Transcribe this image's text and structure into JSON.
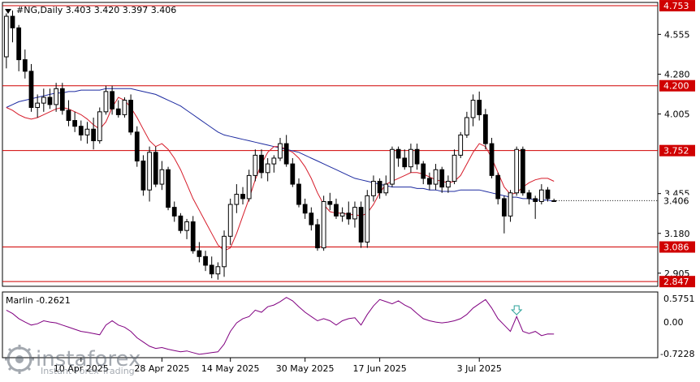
{
  "header": {
    "symbol_line": "#NG,Daily  3.403 3.420 3.397 3.406"
  },
  "indicator": {
    "label": "Marlin -0.2621",
    "levels": [
      "0.5751",
      "0.00",
      "-0.7228"
    ],
    "arrow_icon": "down-arrow-icon"
  },
  "watermark": {
    "brand": "instaforex",
    "tagline": "Instant Forex Trading"
  },
  "colors": {
    "candle": "#000000",
    "ma_fast": "#d61c2a",
    "ma_slow": "#1c2aa0",
    "level_line": "#d00000",
    "indicator_line": "#800080",
    "arrow": "#2aa198",
    "label_bg": "#d00000"
  },
  "chart_data": {
    "type": "candlestick",
    "symbol": "#NG",
    "timeframe": "Daily",
    "last_price": "3.406",
    "price_axis_ticks": [
      "4.555",
      "4.280",
      "4.005",
      "3.455",
      "3.180",
      "2.905"
    ],
    "x_axis_labels": [
      "10 Apr 2025",
      "28 Apr 2025",
      "14 May 2025",
      "30 May 2025",
      "17 Jun 2025",
      "3 Jul 2025"
    ],
    "ylim": [
      2.82,
      4.77
    ],
    "levels": [
      {
        "value": 4.753,
        "label": "4.753"
      },
      {
        "value": 4.2,
        "label": "4.200"
      },
      {
        "value": 3.752,
        "label": "3.752"
      },
      {
        "value": 3.086,
        "label": "3.086"
      },
      {
        "value": 2.847,
        "label": "2.847"
      }
    ],
    "candles": [
      [
        4.4,
        4.7,
        4.32,
        4.68
      ],
      [
        4.68,
        4.72,
        4.5,
        4.6
      ],
      [
        4.6,
        4.62,
        4.3,
        4.38
      ],
      [
        4.38,
        4.45,
        4.25,
        4.3
      ],
      [
        4.3,
        4.35,
        4.02,
        4.05
      ],
      [
        4.05,
        4.14,
        3.98,
        4.08
      ],
      [
        4.08,
        4.18,
        4.02,
        4.12
      ],
      [
        4.12,
        4.18,
        4.04,
        4.07
      ],
      [
        4.07,
        4.22,
        4.02,
        4.18
      ],
      [
        4.18,
        4.22,
        4.0,
        4.03
      ],
      [
        4.03,
        4.1,
        3.92,
        3.96
      ],
      [
        3.96,
        4.02,
        3.88,
        3.92
      ],
      [
        3.92,
        3.96,
        3.82,
        3.86
      ],
      [
        3.86,
        3.95,
        3.8,
        3.9
      ],
      [
        3.9,
        3.98,
        3.76,
        3.82
      ],
      [
        3.82,
        4.05,
        3.8,
        4.02
      ],
      [
        4.02,
        4.2,
        4.0,
        4.16
      ],
      [
        4.16,
        4.2,
        4.0,
        4.04
      ],
      [
        4.04,
        4.1,
        3.98,
        4.0
      ],
      [
        4.0,
        4.12,
        3.98,
        4.1
      ],
      [
        4.1,
        4.14,
        3.86,
        3.88
      ],
      [
        3.88,
        3.92,
        3.64,
        3.68
      ],
      [
        3.68,
        3.72,
        3.44,
        3.48
      ],
      [
        3.48,
        3.78,
        3.4,
        3.74
      ],
      [
        3.74,
        3.78,
        3.5,
        3.52
      ],
      [
        3.52,
        3.68,
        3.48,
        3.62
      ],
      [
        3.62,
        3.64,
        3.34,
        3.36
      ],
      [
        3.36,
        3.4,
        3.26,
        3.3
      ],
      [
        3.3,
        3.32,
        3.18,
        3.2
      ],
      [
        3.2,
        3.28,
        3.14,
        3.26
      ],
      [
        3.26,
        3.3,
        3.04,
        3.06
      ],
      [
        3.06,
        3.12,
        2.98,
        3.02
      ],
      [
        3.02,
        3.06,
        2.92,
        2.96
      ],
      [
        2.96,
        3.02,
        2.87,
        2.9
      ],
      [
        2.9,
        2.98,
        2.86,
        2.95
      ],
      [
        2.95,
        3.2,
        2.88,
        3.16
      ],
      [
        3.16,
        3.42,
        3.1,
        3.38
      ],
      [
        3.38,
        3.52,
        3.32,
        3.45
      ],
      [
        3.45,
        3.5,
        3.38,
        3.42
      ],
      [
        3.42,
        3.62,
        3.4,
        3.58
      ],
      [
        3.58,
        3.76,
        3.54,
        3.72
      ],
      [
        3.72,
        3.76,
        3.56,
        3.6
      ],
      [
        3.6,
        3.7,
        3.54,
        3.66
      ],
      [
        3.66,
        3.72,
        3.6,
        3.7
      ],
      [
        3.7,
        3.84,
        3.68,
        3.8
      ],
      [
        3.8,
        3.86,
        3.64,
        3.66
      ],
      [
        3.66,
        3.7,
        3.5,
        3.52
      ],
      [
        3.52,
        3.56,
        3.36,
        3.38
      ],
      [
        3.38,
        3.42,
        3.28,
        3.32
      ],
      [
        3.32,
        3.36,
        3.2,
        3.24
      ],
      [
        3.24,
        3.28,
        3.06,
        3.08
      ],
      [
        3.08,
        3.44,
        3.06,
        3.4
      ],
      [
        3.4,
        3.46,
        3.34,
        3.38
      ],
      [
        3.38,
        3.42,
        3.28,
        3.3
      ],
      [
        3.3,
        3.36,
        3.26,
        3.32
      ],
      [
        3.32,
        3.4,
        3.24,
        3.28
      ],
      [
        3.28,
        3.4,
        3.22,
        3.36
      ],
      [
        3.36,
        3.4,
        3.08,
        3.12
      ],
      [
        3.12,
        3.48,
        3.08,
        3.44
      ],
      [
        3.44,
        3.58,
        3.4,
        3.54
      ],
      [
        3.54,
        3.56,
        3.42,
        3.46
      ],
      [
        3.46,
        3.58,
        3.44,
        3.52
      ],
      [
        3.52,
        3.78,
        3.5,
        3.76
      ],
      [
        3.76,
        3.78,
        3.64,
        3.7
      ],
      [
        3.7,
        3.76,
        3.62,
        3.64
      ],
      [
        3.64,
        3.8,
        3.6,
        3.76
      ],
      [
        3.76,
        3.8,
        3.62,
        3.66
      ],
      [
        3.66,
        3.68,
        3.52,
        3.56
      ],
      [
        3.56,
        3.6,
        3.48,
        3.52
      ],
      [
        3.52,
        3.66,
        3.48,
        3.62
      ],
      [
        3.62,
        3.64,
        3.46,
        3.5
      ],
      [
        3.5,
        3.58,
        3.46,
        3.54
      ],
      [
        3.54,
        3.76,
        3.52,
        3.72
      ],
      [
        3.72,
        3.88,
        3.7,
        3.86
      ],
      [
        3.86,
        4.02,
        3.84,
        3.98
      ],
      [
        3.98,
        4.14,
        3.92,
        4.1
      ],
      [
        4.1,
        4.16,
        3.96,
        4.0
      ],
      [
        4.0,
        4.04,
        3.76,
        3.8
      ],
      [
        3.8,
        3.84,
        3.56,
        3.58
      ],
      [
        3.58,
        3.6,
        3.38,
        3.42
      ],
      [
        3.42,
        3.44,
        3.18,
        3.3
      ],
      [
        3.3,
        3.48,
        3.26,
        3.46
      ],
      [
        3.46,
        3.78,
        3.44,
        3.76
      ],
      [
        3.76,
        3.78,
        3.44,
        3.46
      ],
      [
        3.46,
        3.48,
        3.38,
        3.42
      ],
      [
        3.42,
        3.44,
        3.28,
        3.4
      ],
      [
        3.4,
        3.52,
        3.38,
        3.48
      ],
      [
        3.48,
        3.5,
        3.4,
        3.42
      ],
      [
        3.403,
        3.42,
        3.397,
        3.406
      ]
    ],
    "ma_fast": [
      4.05,
      4.03,
      4.0,
      3.98,
      3.97,
      3.98,
      4.0,
      4.02,
      4.04,
      4.05,
      4.04,
      4.02,
      4.0,
      3.97,
      3.93,
      3.9,
      3.95,
      4.05,
      4.12,
      4.1,
      4.05,
      3.98,
      3.9,
      3.82,
      3.78,
      3.8,
      3.76,
      3.7,
      3.62,
      3.52,
      3.42,
      3.34,
      3.26,
      3.18,
      3.1,
      3.06,
      3.08,
      3.18,
      3.3,
      3.42,
      3.55,
      3.66,
      3.74,
      3.78,
      3.78,
      3.76,
      3.74,
      3.7,
      3.64,
      3.56,
      3.46,
      3.38,
      3.33,
      3.32,
      3.32,
      3.31,
      3.31,
      3.3,
      3.32,
      3.38,
      3.46,
      3.52,
      3.54,
      3.56,
      3.58,
      3.6,
      3.6,
      3.59,
      3.57,
      3.55,
      3.54,
      3.53,
      3.54,
      3.58,
      3.66,
      3.74,
      3.8,
      3.78,
      3.7,
      3.6,
      3.5,
      3.45,
      3.46,
      3.5,
      3.53,
      3.55,
      3.56,
      3.56,
      3.54
    ],
    "ma_slow": [
      4.05,
      4.07,
      4.09,
      4.1,
      4.11,
      4.12,
      4.13,
      4.14,
      4.15,
      4.15,
      4.16,
      4.16,
      4.17,
      4.17,
      4.17,
      4.17,
      4.18,
      4.18,
      4.18,
      4.18,
      4.18,
      4.17,
      4.16,
      4.15,
      4.14,
      4.12,
      4.1,
      4.08,
      4.06,
      4.03,
      4.0,
      3.97,
      3.94,
      3.91,
      3.88,
      3.86,
      3.85,
      3.84,
      3.83,
      3.82,
      3.81,
      3.8,
      3.79,
      3.78,
      3.77,
      3.76,
      3.75,
      3.74,
      3.72,
      3.7,
      3.68,
      3.66,
      3.64,
      3.62,
      3.6,
      3.58,
      3.56,
      3.55,
      3.54,
      3.53,
      3.52,
      3.51,
      3.5,
      3.5,
      3.5,
      3.5,
      3.49,
      3.49,
      3.48,
      3.48,
      3.47,
      3.47,
      3.47,
      3.48,
      3.48,
      3.48,
      3.48,
      3.47,
      3.46,
      3.45,
      3.44,
      3.43,
      3.43,
      3.42,
      3.42,
      3.41,
      3.41,
      3.41,
      3.4
    ],
    "marlin_values": [
      0.3,
      0.22,
      0.1,
      0.02,
      -0.05,
      -0.02,
      0.05,
      0.02,
      0.0,
      -0.05,
      -0.1,
      -0.15,
      -0.2,
      -0.22,
      -0.25,
      -0.28,
      -0.05,
      0.05,
      -0.05,
      -0.1,
      -0.2,
      -0.35,
      -0.45,
      -0.55,
      -0.6,
      -0.58,
      -0.62,
      -0.65,
      -0.68,
      -0.66,
      -0.7,
      -0.74,
      -0.72,
      -0.7,
      -0.68,
      -0.5,
      -0.2,
      0.0,
      0.1,
      0.15,
      0.3,
      0.25,
      0.38,
      0.42,
      0.5,
      0.6,
      0.52,
      0.38,
      0.25,
      0.15,
      0.05,
      0.1,
      0.05,
      -0.05,
      0.05,
      0.1,
      0.12,
      -0.05,
      0.2,
      0.4,
      0.55,
      0.5,
      0.45,
      0.52,
      0.42,
      0.35,
      0.22,
      0.1,
      0.05,
      0.02,
      0.0,
      0.02,
      0.05,
      0.1,
      0.2,
      0.35,
      0.45,
      0.55,
      0.35,
      0.1,
      -0.05,
      -0.2,
      0.15,
      -0.2,
      -0.25,
      -0.2,
      -0.3,
      -0.26,
      -0.2621
    ]
  }
}
